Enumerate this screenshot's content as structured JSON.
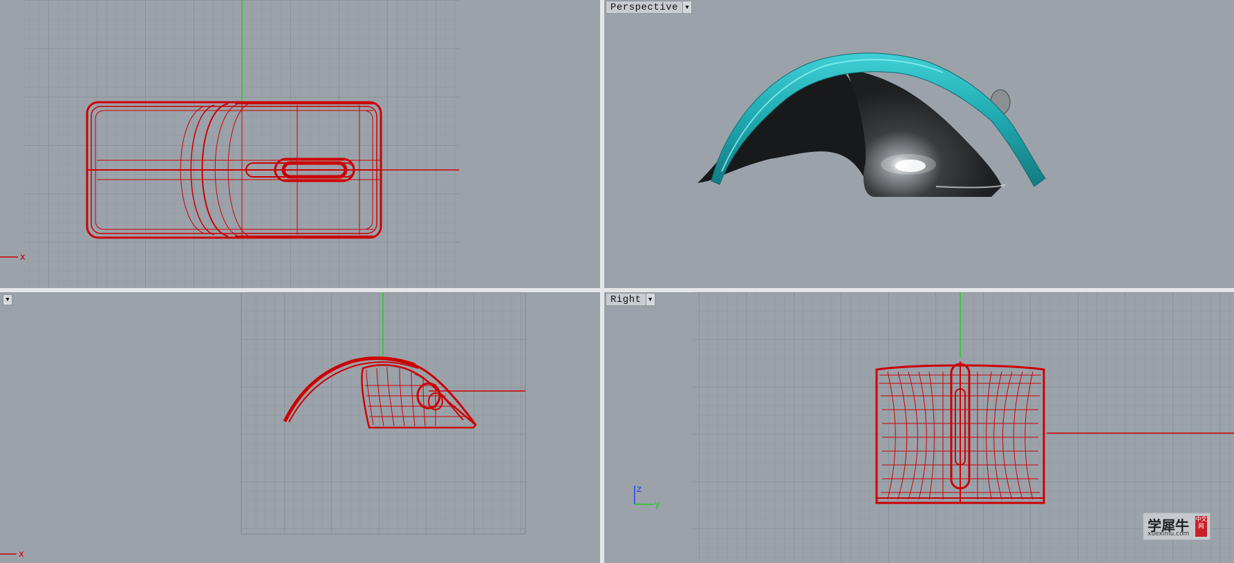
{
  "viewports": {
    "top": {
      "label": "",
      "x_axis": "x"
    },
    "perspective": {
      "label": "Perspective"
    },
    "front": {
      "label": "",
      "x_axis": "x"
    },
    "right": {
      "label": "Right",
      "z_axis": "z",
      "y_axis": "y"
    }
  },
  "watermark": {
    "cn": "学犀牛",
    "en": "xuexiniu.com",
    "stamp": "中文网"
  },
  "colors": {
    "viewport_bg": "#9ba2aa",
    "grid": "#8a9097",
    "wire": "#cc0000",
    "x_axis": "#cc0000",
    "y_axis": "#22cc22",
    "z_axis": "#2244dd",
    "shell": "#1fa8b0",
    "body": "#2a2c2e"
  }
}
